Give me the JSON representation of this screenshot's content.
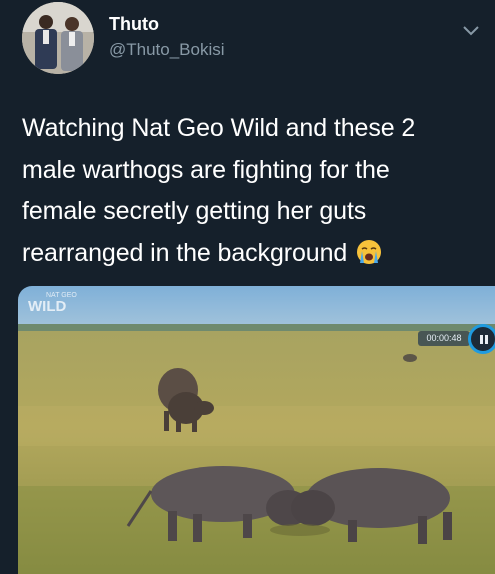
{
  "author": {
    "name": "Thuto",
    "handle": "@Thuto_Bokisi"
  },
  "tweet": {
    "lines": [
      "Watching Nat Geo Wild and these 2",
      "male warthogs are fighting for the",
      "female secretly getting her guts",
      "rearranged in the background"
    ],
    "emoji": "crying-face-emoji"
  },
  "media": {
    "channel_logo_small": "NAT GEO",
    "channel_logo_big": "WILD",
    "timestamp": "00:00:48",
    "playback_state": "paused"
  },
  "colors": {
    "background": "#15202b",
    "text_primary": "#ffffff",
    "text_secondary": "#8899a6",
    "accent": "#1f9be0"
  },
  "icons": {
    "menu": "chevron-down-icon",
    "pause": "pause-icon"
  }
}
